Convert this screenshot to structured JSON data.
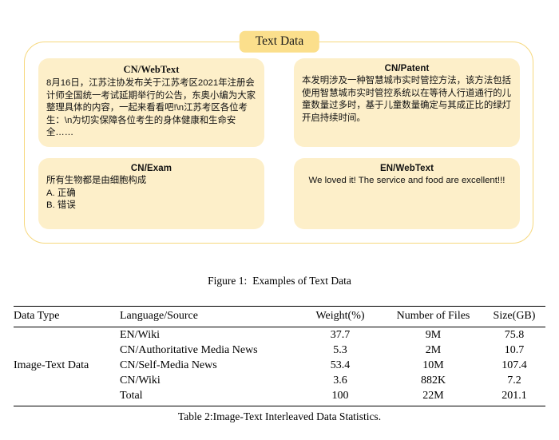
{
  "figure": {
    "badge_label": "Text Data",
    "caption_label": "Figure 1:",
    "caption_text": "Examples of Text Data",
    "accent_border_color": "#f6d87e",
    "badge_color": "#fbdf8c",
    "card_color": "#fdefc9",
    "cards": [
      {
        "title": "CN/WebText",
        "body": "8月16日，江苏注协发布关于江苏考区2021年注册会计师全国统一考试延期举行的公告，东奥小编为大家整理具体的内容，一起来看看吧!\\n江苏考区各位考生：\\n为切实保障各位考生的身体健康和生命安全……"
      },
      {
        "title": "CN/Patent",
        "body": "本发明涉及一种智慧城市实时管控方法，该方法包括使用智慧城市实时管控系统以在等待人行道通行的儿童数量过多时，基于儿童数量确定与其成正比的绿灯开启持续时间。"
      },
      {
        "title": "CN/Exam",
        "body": "所有生物都是由细胞构成\nA. 正确\nB. 错误"
      },
      {
        "title": "EN/WebText",
        "body": "We loved it! The service and food are excellent!!!"
      }
    ]
  },
  "table": {
    "caption_label": "Table 2:",
    "caption_text": "Image-Text Interleaved Data Statistics.",
    "columns": [
      "Data Type",
      "Language/Source",
      "Weight(%)",
      "Number of Files",
      "Size(GB)"
    ],
    "row_group_label": "Image-Text Data",
    "rows": [
      {
        "source": "EN/Wiki",
        "weight": "37.7",
        "files": "9M",
        "size": "75.8"
      },
      {
        "source": "CN/Authoritative Media News",
        "weight": "5.3",
        "files": "2M",
        "size": "10.7"
      },
      {
        "source": "CN/Self-Media News",
        "weight": "53.4",
        "files": "10M",
        "size": "107.4"
      },
      {
        "source": "CN/Wiki",
        "weight": "3.6",
        "files": "882K",
        "size": "7.2"
      },
      {
        "source": "Total",
        "weight": "100",
        "files": "22M",
        "size": "201.1"
      }
    ]
  }
}
